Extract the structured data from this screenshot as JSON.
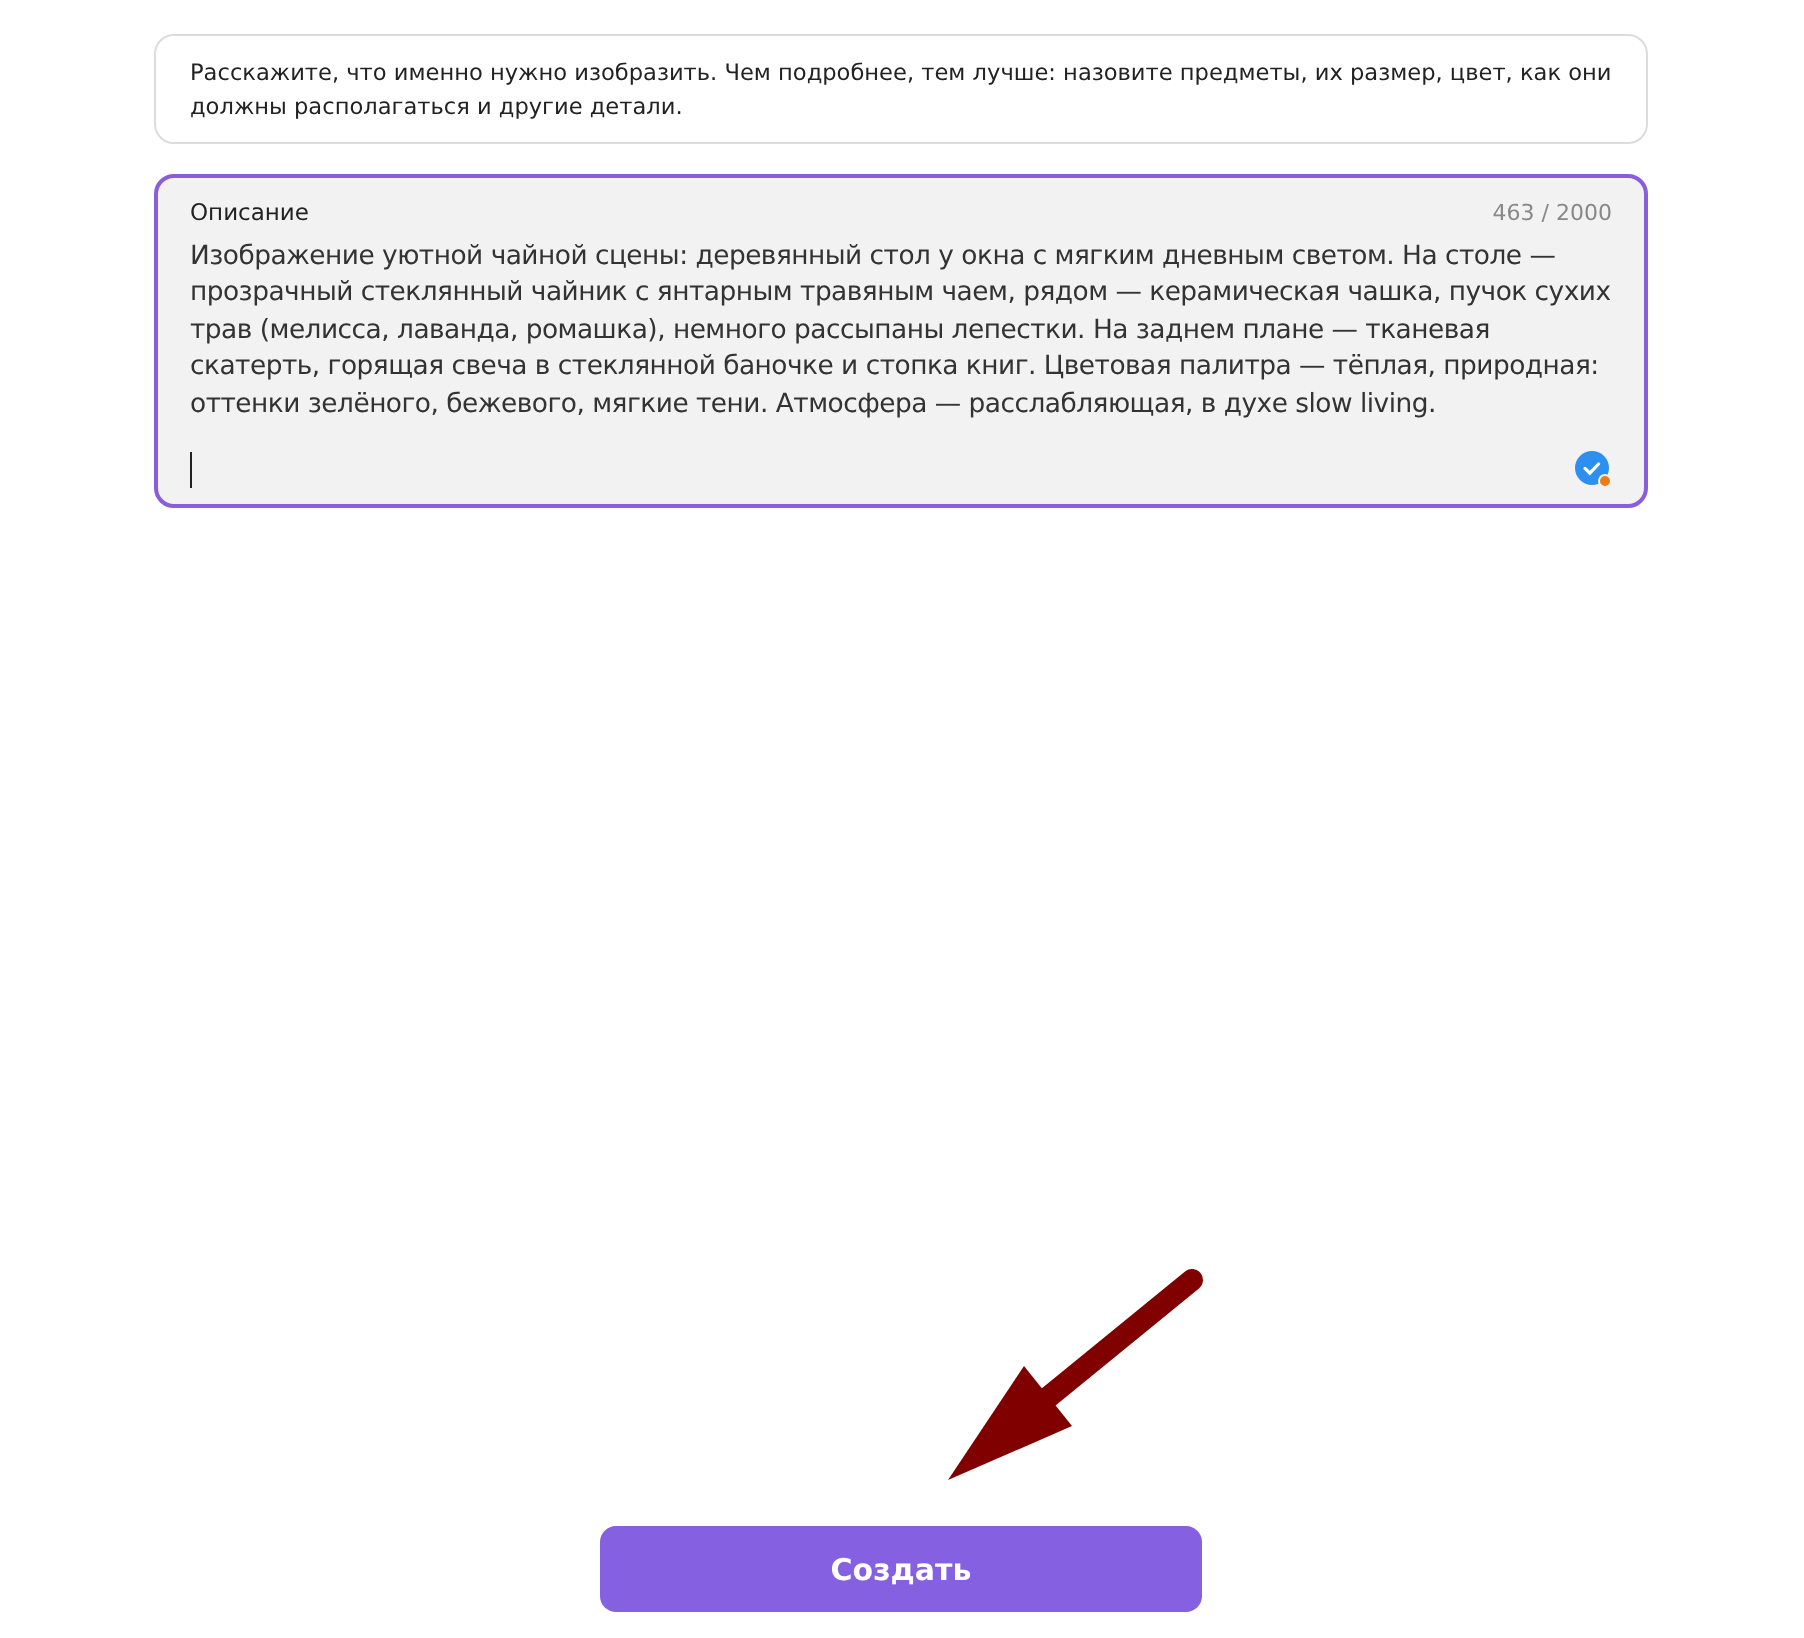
{
  "hint": "Расскажите, что именно нужно изобразить. Чем подробнее, тем лучше: назовите предметы, их размер, цвет, как они должны располагаться и другие детали.",
  "description": {
    "label": "Описание",
    "counter": "463 / 2000",
    "value": "Изображение уютной чайной сцены: деревянный стол у окна с мягким дневным светом. На столе — прозрачный стеклянный чайник с янтарным травяным чаем, рядом — керамическая чашка, пучок сухих трав (мелисса, лаванда, ромашка), немного рассыпаны лепестки. На заднем плане — тканевая скатерть, горящая свеча в стеклянной баночке и стопка книг. Цветовая палитра — тёплая, природная: оттенки зелёного, бежевого, мягкие тени. Атмосфера — расслабляющая, в духе slow living.",
    "focused": true
  },
  "button": {
    "label": "Создать"
  }
}
